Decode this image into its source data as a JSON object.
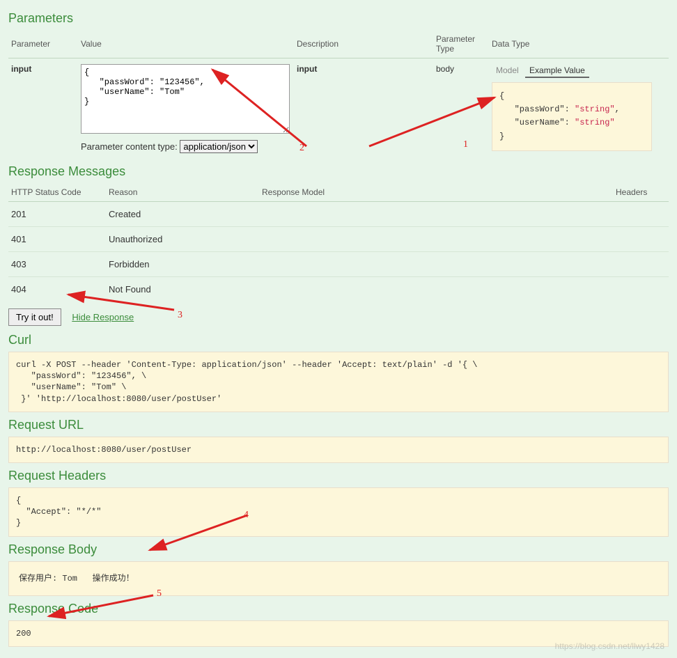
{
  "sections": {
    "parameters": "Parameters",
    "response_messages": "Response Messages",
    "curl": "Curl",
    "request_url": "Request URL",
    "request_headers": "Request Headers",
    "response_body": "Response Body",
    "response_code": "Response Code"
  },
  "params_table": {
    "headers": {
      "parameter": "Parameter",
      "value": "Value",
      "description": "Description",
      "parameter_type": "Parameter Type",
      "data_type": "Data Type"
    },
    "row": {
      "name": "input",
      "value": "{\n   \"passWord\": \"123456\",\n   \"userName\": \"Tom\"\n}",
      "description": "input",
      "parameter_type": "body"
    },
    "content_type_label": "Parameter content type:",
    "content_type_value": "application/json",
    "tabs": {
      "model": "Model",
      "example": "Example Value"
    },
    "example_json": {
      "passWord": "string",
      "userName": "string"
    }
  },
  "response_table": {
    "headers": {
      "status": "HTTP Status Code",
      "reason": "Reason",
      "model": "Response Model",
      "headers": "Headers"
    },
    "rows": [
      {
        "code": "201",
        "reason": "Created"
      },
      {
        "code": "401",
        "reason": "Unauthorized"
      },
      {
        "code": "403",
        "reason": "Forbidden"
      },
      {
        "code": "404",
        "reason": "Not Found"
      }
    ]
  },
  "actions": {
    "try": "Try it out!",
    "hide": "Hide Response"
  },
  "curl_text": "curl -X POST --header 'Content-Type: application/json' --header 'Accept: text/plain' -d '{ \\\n   \"passWord\": \"123456\", \\\n   \"userName\": \"Tom\" \\\n }' 'http://localhost:8080/user/postUser'",
  "request_url": "http://localhost:8080/user/postUser",
  "request_headers_text": "{\n  \"Accept\": \"*/*\"\n}",
  "response_body_text": "保存用户: Tom   操作成功！",
  "response_code_value": "200",
  "annotations": {
    "n1": "1",
    "n2": "2",
    "n3": "3",
    "n4": "4",
    "n5": "5"
  },
  "watermark": "https://blog.csdn.net/llwy1428"
}
